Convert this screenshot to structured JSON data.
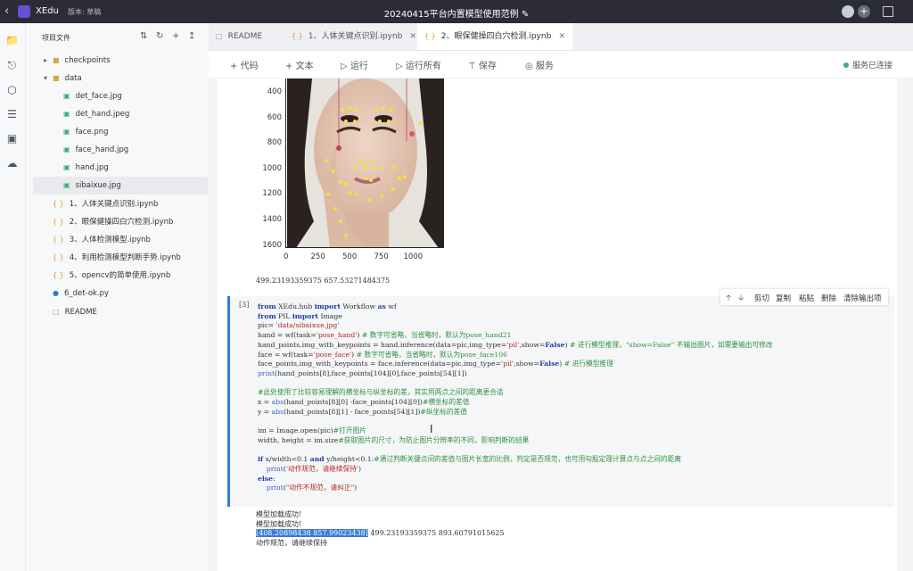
{
  "app": {
    "name": "XEdu",
    "version": "版本: 草稿",
    "document_title": "20240415平台内置模型使用范例"
  },
  "sidebar": {
    "title": "项目文件",
    "items": [
      {
        "label": "checkpoints",
        "type": "folder",
        "expanded": false
      },
      {
        "label": "data",
        "type": "folder",
        "expanded": true
      },
      {
        "label": "det_face.jpg",
        "type": "image"
      },
      {
        "label": "det_hand.jpeg",
        "type": "image"
      },
      {
        "label": "face.png",
        "type": "image"
      },
      {
        "label": "face_hand.jpg",
        "type": "image"
      },
      {
        "label": "hand.jpg",
        "type": "image"
      },
      {
        "label": "sibaixue.jpg",
        "type": "image",
        "selected": true
      },
      {
        "label": "1、人体关键点识别.ipynb",
        "type": "notebook"
      },
      {
        "label": "2、眼保健操四白穴检测.ipynb",
        "type": "notebook"
      },
      {
        "label": "3、人体检测模型.ipynb",
        "type": "notebook"
      },
      {
        "label": "4、利用检测模型判断手势.ipynb",
        "type": "notebook"
      },
      {
        "label": "5、opencv的简单使用.ipynb",
        "type": "notebook"
      },
      {
        "label": "6_det-ok.py",
        "type": "python"
      },
      {
        "label": "README",
        "type": "text"
      }
    ]
  },
  "tabs": [
    {
      "label": "README",
      "active": false
    },
    {
      "label": "1、人体关键点识别.ipynb",
      "active": false
    },
    {
      "label": "2、眼保健操四白穴检测.ipynb",
      "active": true
    }
  ],
  "toolbar": {
    "code": "代码",
    "text": "文本",
    "run": "运行",
    "run_all": "运行所有",
    "save": "保存",
    "service": "服务",
    "status": "服务已连接"
  },
  "plot": {
    "yticks": [
      "400",
      "600",
      "800",
      "1000",
      "1200",
      "1400",
      "1600"
    ],
    "xticks": [
      "0",
      "250",
      "500",
      "750",
      "1000"
    ]
  },
  "prev_output": "499.23193359375 657.53271484375",
  "cell": {
    "prompt": "[3]",
    "tools": {
      "cut": "剪切",
      "copy": "复制",
      "paste": "粘贴",
      "delete": "删除",
      "clear": "清除输出项"
    },
    "lines": [
      "from XEdu.hub import Workflow as wf",
      "from PIL import Image",
      "pic= 'data/sibaixue.jpg'",
      "hand = wf(task='pose_hand') # 数字可省略，当省略时，默认为pose_hand21",
      "hand_points,img_with_keypoints = hand.inference(data=pic,img_type='pil',show=False) # 进行模型推理，“show=False” 不输出图片，如需要输出可修改",
      "face = wf(task='pose_face') # 数字可省略，当省略时，默认为pose_face106",
      "face_points,img_with_keypoints = face.inference(data=pic,img_type='pil',show=False) # 进行模型推理",
      "print(hand_points[8],face_points[104][0],face_points[54][1])",
      "",
      "#此处使用了比较容易理解的横坐标与纵坐标的差，其实用两点之间的距离更合适",
      "x = abs(hand_points[8][0] -face_points[104][0])#横坐标的差值",
      "y = abs(hand_points[8][1] - face_points[54][1])#纵坐标的差值",
      "",
      "im = Image.open(pic)#打开图片",
      "width, height = im.size#获取图片的尺寸，为防止图片分辨率的不同，影响判断的结果",
      "",
      "if x/width<0.1 and y/height<0.1:#通过判断关键点间的差值与图片长宽的比例，判定是否规范，也可用勾股定理计算点与点之间的距离",
      "    print('动作规范，请继续保持')",
      "else:",
      "    print(\"动作不规范，请纠正\")"
    ]
  },
  "output": {
    "line1": "模型加载成功!",
    "line2": "模型加载成功!",
    "highlight": "[408.20898438 857.99023438]",
    "line3_rest": " 499.23193359375 893.60791015625",
    "line4": "动作规范，请继续保持"
  }
}
